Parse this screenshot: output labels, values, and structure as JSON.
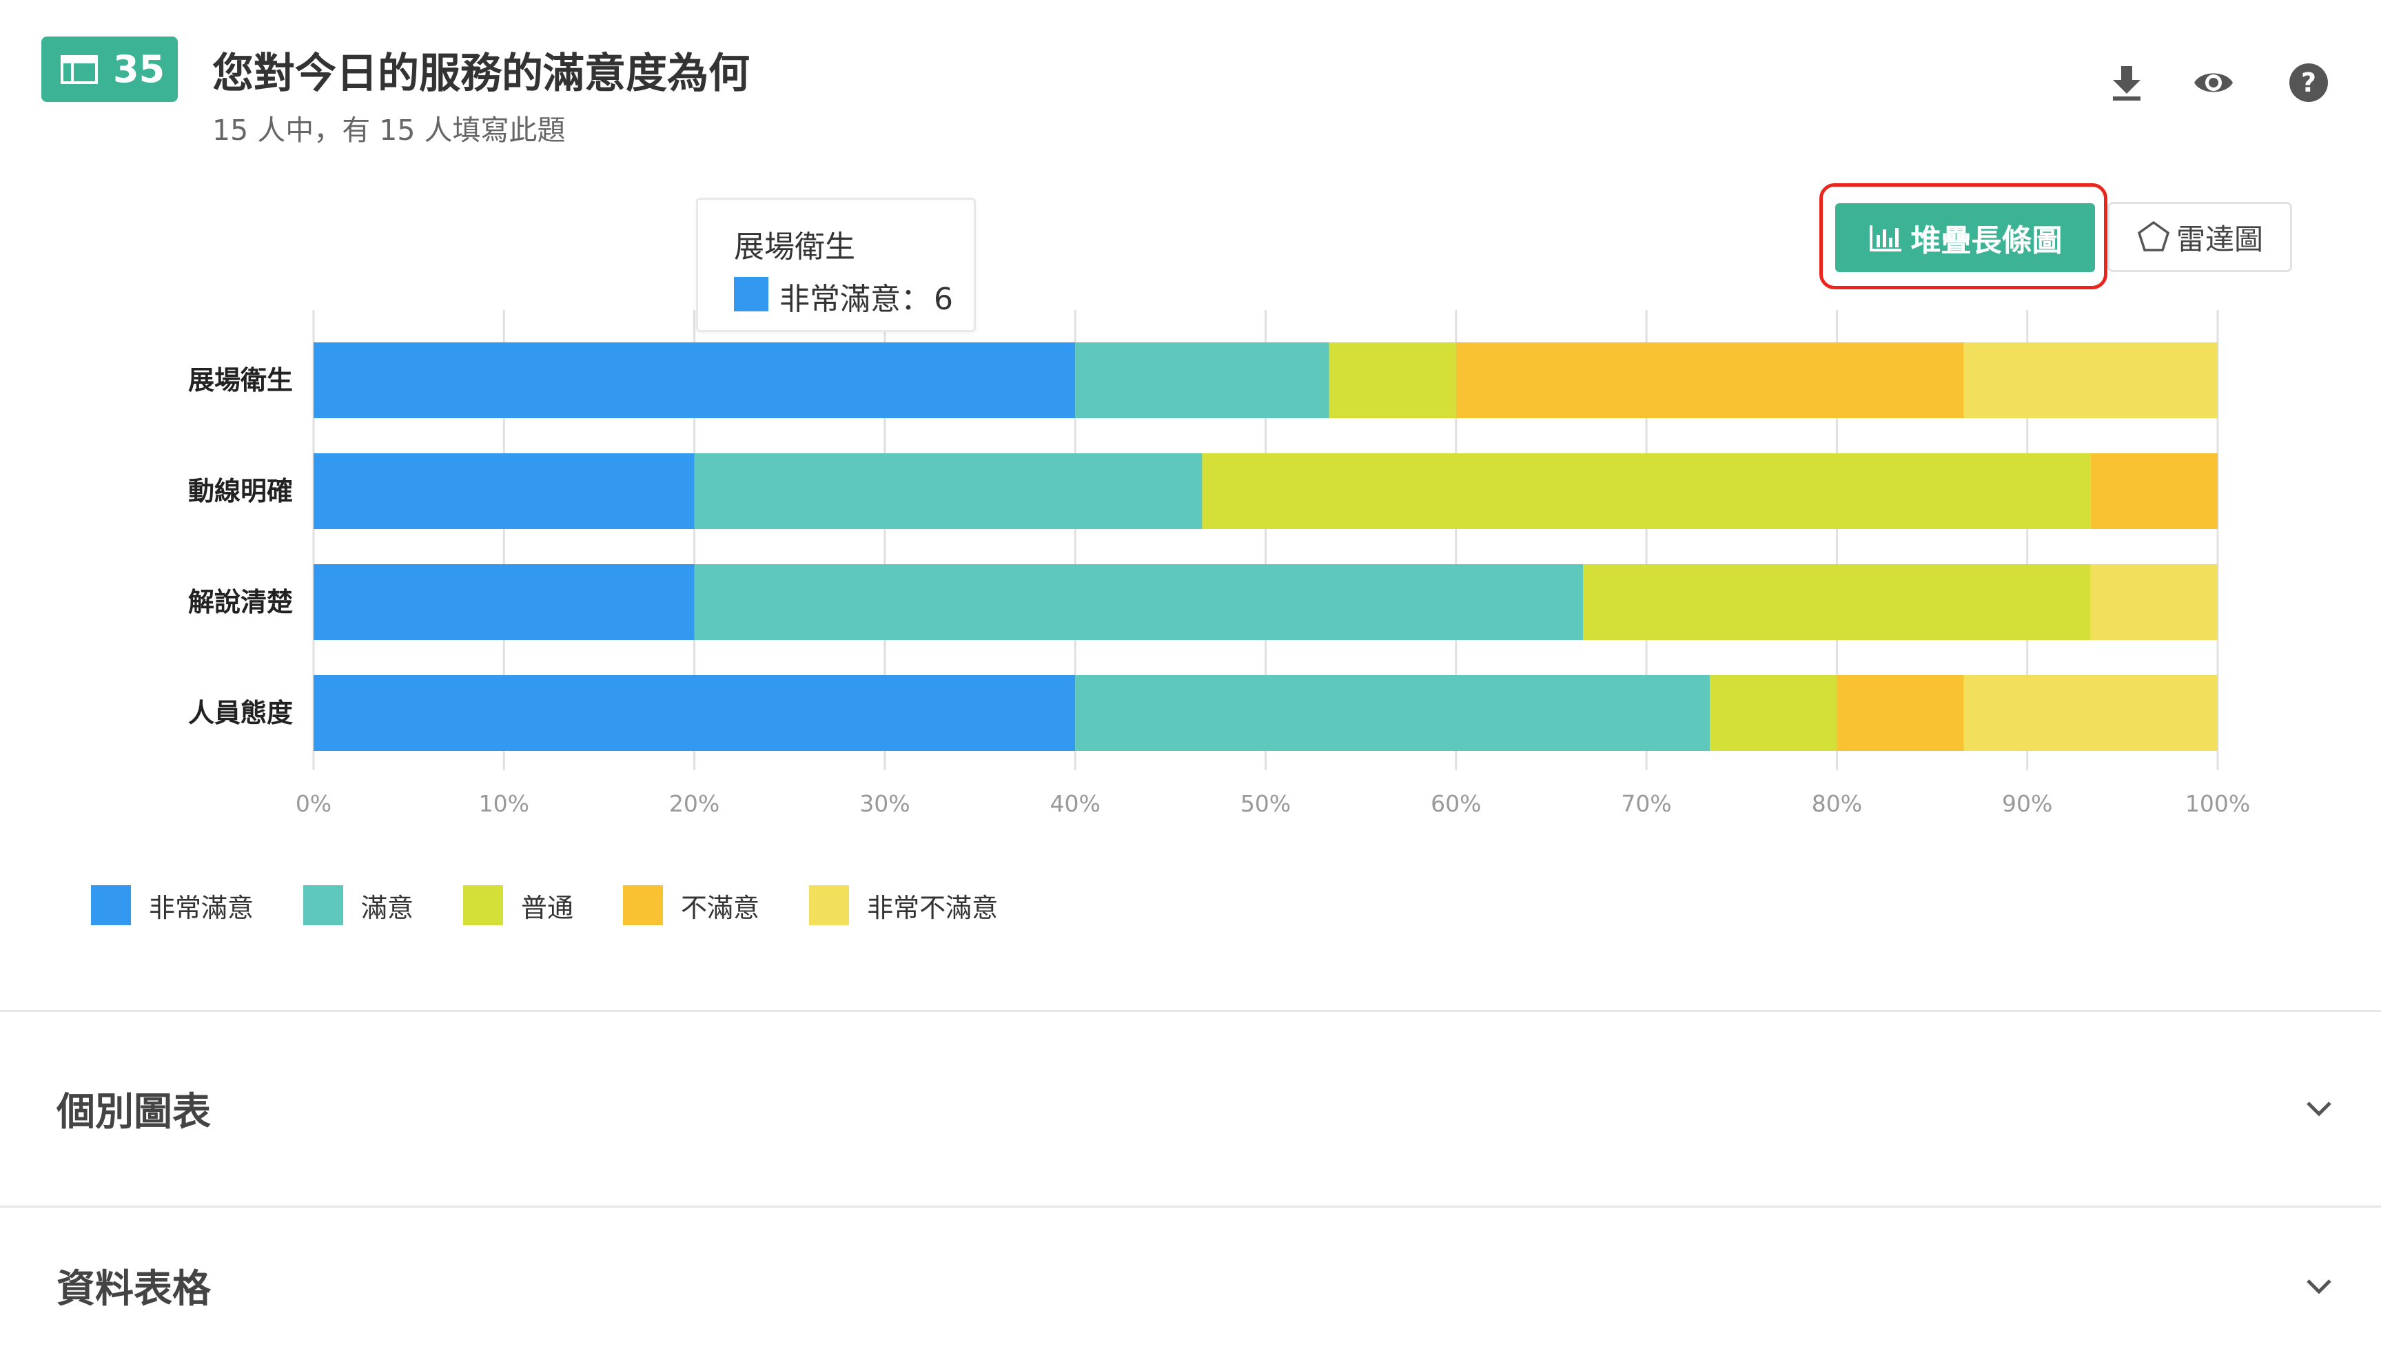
{
  "header": {
    "question_number": "35",
    "title": "您對今日的服務的滿意度為何",
    "subtitle": "15 人中，有 15 人填寫此題",
    "icons": [
      "download-icon",
      "eye-icon",
      "help-icon"
    ]
  },
  "view_toggle": {
    "stacked_label": "堆疊長條圖",
    "radar_label": "雷達圖",
    "active": "stacked"
  },
  "tooltip": {
    "category": "展場衛生",
    "series": "非常滿意",
    "separator": "：",
    "value": "6"
  },
  "chart_data": {
    "type": "bar",
    "orientation": "horizontal",
    "stacked": true,
    "percent": true,
    "categories": [
      "展場衛生",
      "動線明確",
      "解說清楚",
      "人員態度"
    ],
    "series": [
      {
        "name": "非常滿意",
        "color": "#3399f0",
        "values": [
          6,
          3,
          3,
          6
        ]
      },
      {
        "name": "滿意",
        "color": "#5ec8bc",
        "values": [
          2,
          4,
          7,
          5
        ]
      },
      {
        "name": "普通",
        "color": "#d4df37",
        "values": [
          1,
          7,
          4,
          1
        ]
      },
      {
        "name": "不滿意",
        "color": "#f9c233",
        "values": [
          4,
          1,
          0,
          1
        ]
      },
      {
        "name": "非常不滿意",
        "color": "#f2e05c",
        "values": [
          2,
          0,
          1,
          2
        ]
      }
    ],
    "x_ticks": [
      "0%",
      "10%",
      "20%",
      "30%",
      "40%",
      "50%",
      "60%",
      "70%",
      "80%",
      "90%",
      "100%"
    ],
    "xlim": [
      0,
      100
    ],
    "grid": true,
    "legend_position": "bottom-left"
  },
  "sections": {
    "individual_charts": "個別圖表",
    "data_table": "資料表格"
  },
  "colors": {
    "accent": "#3bb394",
    "highlight_border": "#e8261e"
  }
}
